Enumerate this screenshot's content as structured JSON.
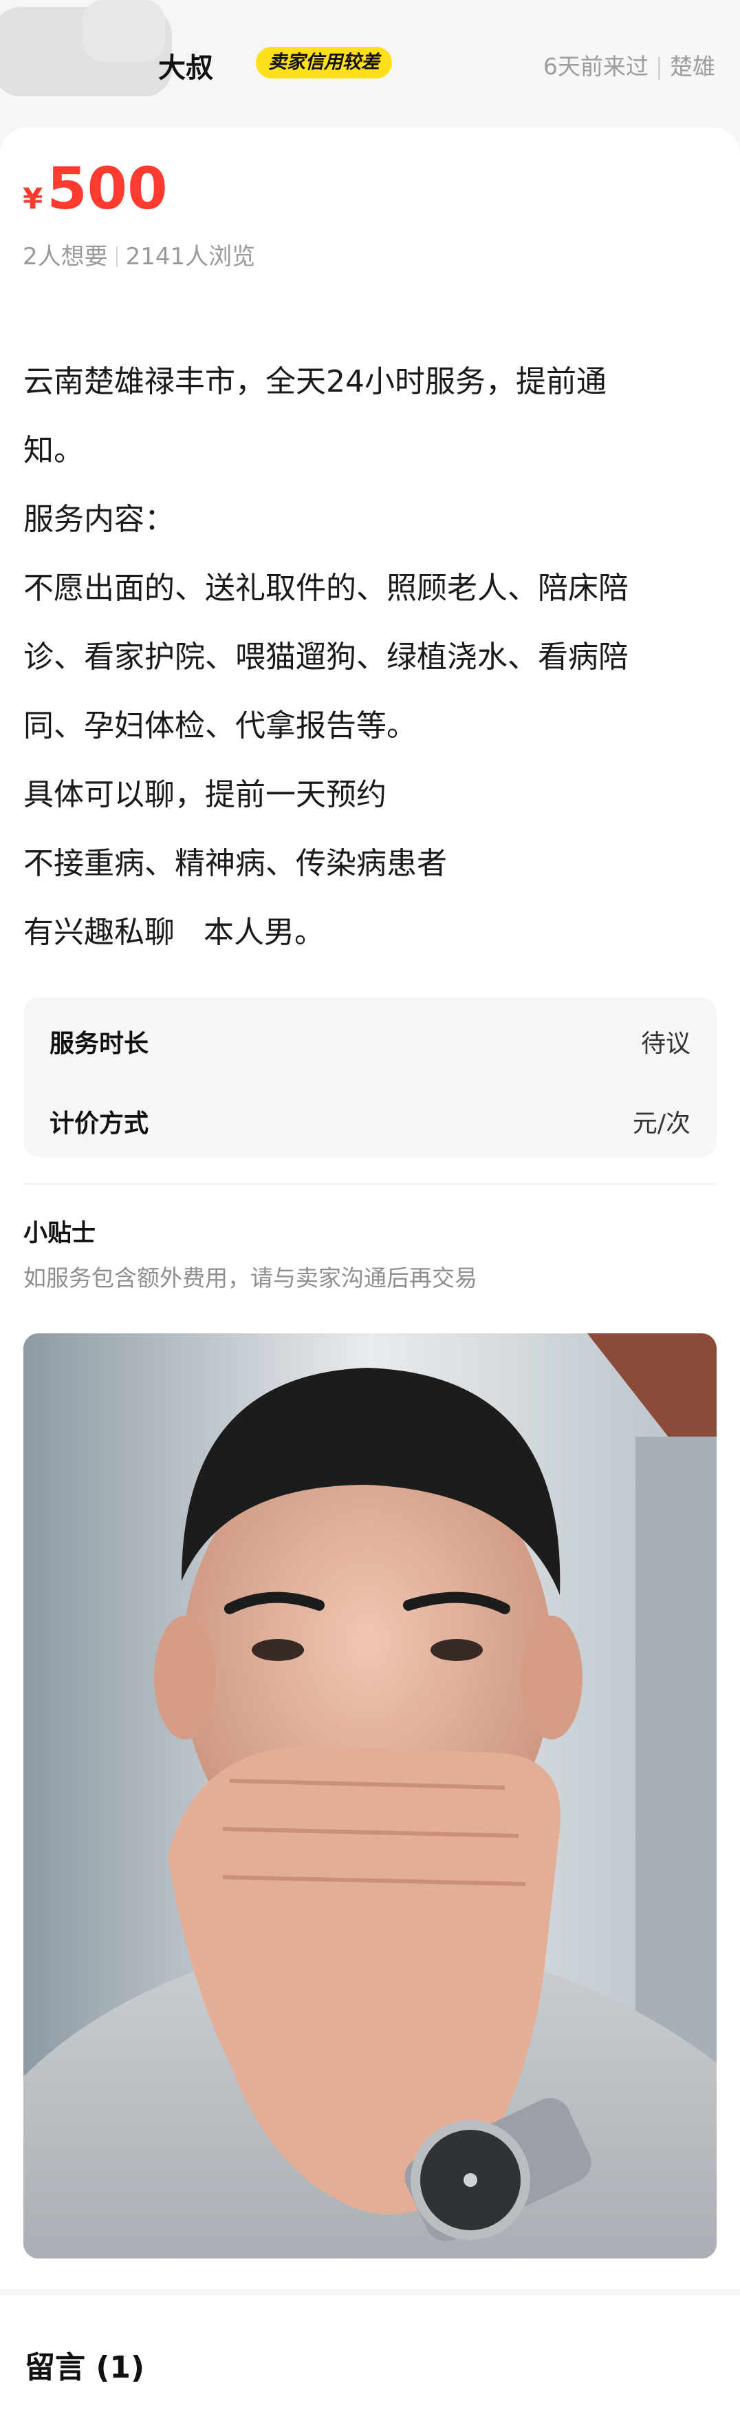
{
  "header": {
    "seller_name": "大叔",
    "credit_badge": "卖家信用较差",
    "last_seen": "6天前来过",
    "location": "楚雄"
  },
  "listing": {
    "currency_symbol": "¥",
    "price": "500",
    "want_count": "2人想要",
    "view_count": "2141人浏览",
    "description": [
      "云南楚雄禄丰市，全天24小时服务，提前通",
      "知。",
      "服务内容：",
      "不愿出面的、送礼取件的、照顾老人、陪床陪",
      "诊、看家护院、喂猫遛狗、绿植浇水、看病陪",
      "同、孕妇体检、代拿报告等。",
      "具体可以聊，提前一天预约",
      "不接重病、精神病、传染病患者",
      "有兴趣私聊   本人男。"
    ],
    "specs": [
      {
        "key": "服务时长",
        "value": "待议"
      },
      {
        "key": "计价方式",
        "value": "元/次"
      }
    ],
    "tips": {
      "title": "小贴士",
      "text": "如服务包含额外费用，请与卖家沟通后再交易"
    }
  },
  "comments": {
    "title": "留言 (1)"
  },
  "colors": {
    "price_red": "#ff3b30",
    "badge_yellow": "#ffe01a",
    "muted_gray": "#9a9a9a"
  }
}
